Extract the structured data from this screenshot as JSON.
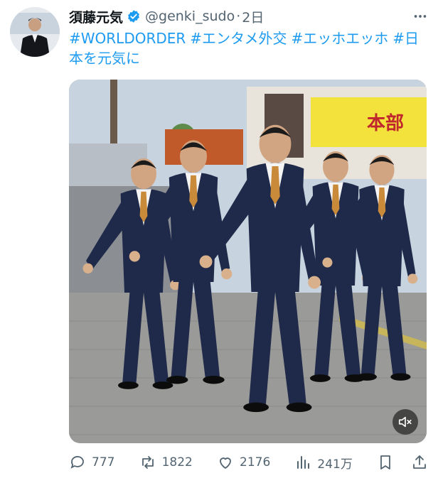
{
  "author": {
    "display_name": "須藤元気",
    "handle": "@genki_sudo",
    "separator": "·",
    "time": "2日",
    "verified": true,
    "avatar_icon": "profile-photo"
  },
  "tweet": {
    "hashtags": [
      "#WORLDORDER",
      "#エンタメ外交",
      "#エッホエッホ",
      "#日本を元気に"
    ]
  },
  "media": {
    "banner_text": "本部",
    "mute_icon": "speaker-muted-icon"
  },
  "actions": {
    "replies": "777",
    "retweets": "1822",
    "likes": "2176",
    "views": "241万"
  },
  "colors": {
    "link": "#1d9bf0",
    "verified": "#1d9bf0",
    "muted_text": "#536471",
    "suit": "#1f2a4a",
    "tie": "#c98a3a",
    "banner": "#f2e23b"
  }
}
